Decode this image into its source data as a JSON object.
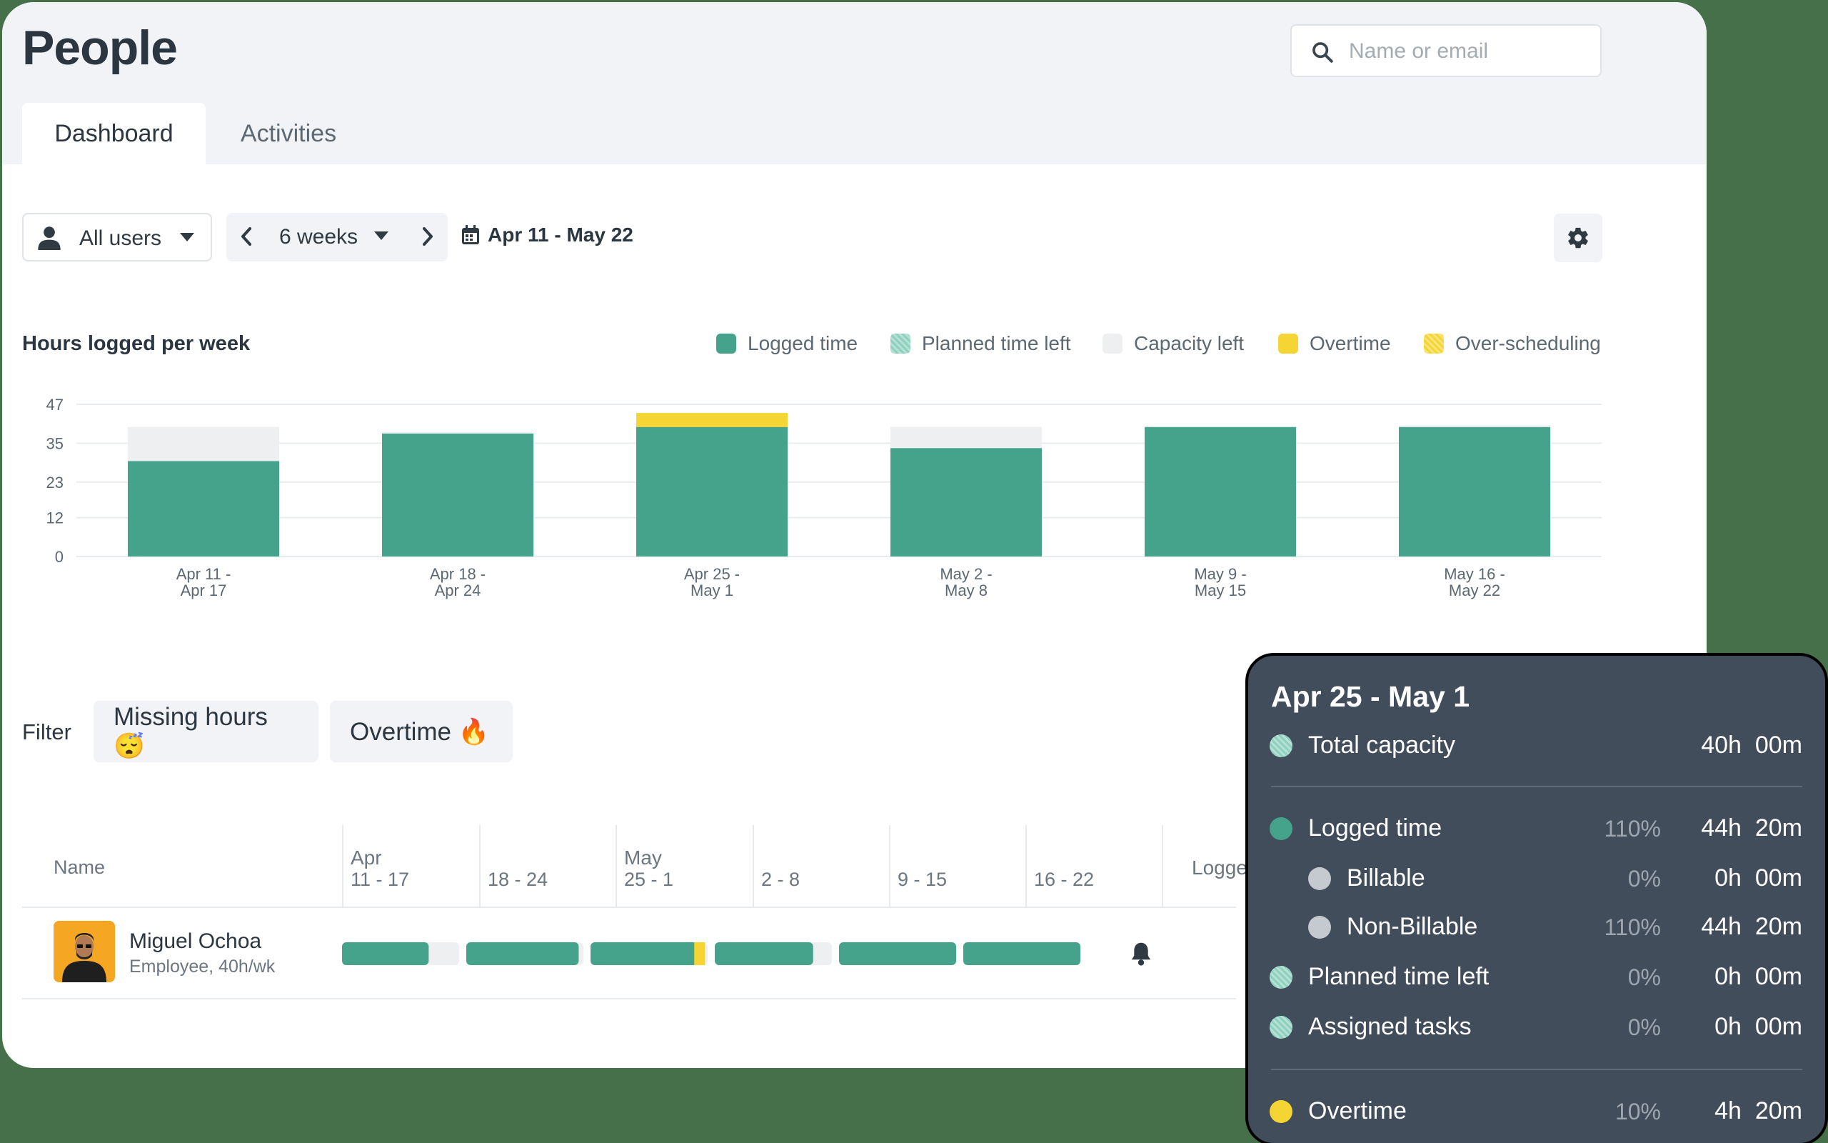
{
  "header": {
    "title": "People",
    "search_placeholder": "Name or email"
  },
  "tabs": [
    {
      "label": "Dashboard",
      "active": true
    },
    {
      "label": "Activities",
      "active": false
    }
  ],
  "toolbar": {
    "users_label": "All users",
    "weeks_label": "6 weeks",
    "date_range": "Apr 11 - May 22"
  },
  "colors": {
    "logged": "#46a38b",
    "planned": "#9fd4c3",
    "capacity": "#eeeff1",
    "overtime": "#f5d533",
    "accent_bg": "#46704a"
  },
  "chart_data": {
    "type": "bar",
    "title": "Hours logged per week",
    "legend": [
      "Logged time",
      "Planned time left",
      "Capacity left",
      "Overtime",
      "Over-scheduling"
    ],
    "legend_position": "top-right",
    "categories": [
      [
        "Apr 11 -",
        "Apr 17"
      ],
      [
        "Apr 18 -",
        "Apr 24"
      ],
      [
        "Apr 25 -",
        "May 1"
      ],
      [
        "May 2 -",
        "May 8"
      ],
      [
        "May 9 -",
        "May 15"
      ],
      [
        "May 16 -",
        "May 22"
      ]
    ],
    "y_ticks": [
      0,
      12,
      23,
      35,
      47
    ],
    "ylim": [
      0,
      47
    ],
    "grid": true,
    "series": [
      {
        "name": "Logged time",
        "values": [
          29.5,
          38,
          40,
          33.5,
          40,
          40
        ]
      },
      {
        "name": "Capacity left",
        "values": [
          10.5,
          0.5,
          0,
          6.5,
          0,
          0.5
        ]
      },
      {
        "name": "Overtime",
        "values": [
          0,
          0,
          4.33,
          0,
          0,
          0
        ]
      }
    ]
  },
  "filter": {
    "label": "Filter",
    "chips": [
      "Missing hours 😴",
      "Overtime 🔥"
    ]
  },
  "table": {
    "name_header": "Name",
    "week_headers": [
      {
        "month": "Apr",
        "range": "11 - 17"
      },
      {
        "month": "",
        "range": "18 - 24"
      },
      {
        "month": "May",
        "range": "25 - 1"
      },
      {
        "month": "",
        "range": "2 - 8"
      },
      {
        "month": "",
        "range": "9 - 15"
      },
      {
        "month": "",
        "range": "16 - 22"
      }
    ],
    "logged_header": "Logge",
    "rows": [
      {
        "name": "Miguel Ochoa",
        "subtitle": "Employee, 40h/wk",
        "week_fill": [
          {
            "logged": 0.74,
            "overtime": 0
          },
          {
            "logged": 0.96,
            "overtime": 0
          },
          {
            "logged": 0.91,
            "overtime": 0.09
          },
          {
            "logged": 0.84,
            "overtime": 0
          },
          {
            "logged": 1.0,
            "overtime": 0
          },
          {
            "logged": 1.0,
            "overtime": 0
          }
        ]
      }
    ]
  },
  "tooltip": {
    "title": "Apr 25 - May 1",
    "rows": [
      {
        "label": "Total capacity",
        "pct": "",
        "hours": "40h  00m",
        "dot": "hatch",
        "indent": false
      },
      {
        "label": "Logged time",
        "pct": "110%",
        "hours": "44h  20m",
        "dot": "#46a38b",
        "indent": false
      },
      {
        "label": "Billable",
        "pct": "0%",
        "hours": "0h  00m",
        "dot": "#c5cad0",
        "indent": true
      },
      {
        "label": "Non-Billable",
        "pct": "110%",
        "hours": "44h  20m",
        "dot": "#c5cad0",
        "indent": true
      },
      {
        "label": "Planned time left",
        "pct": "0%",
        "hours": "0h  00m",
        "dot": "hatch",
        "indent": false
      },
      {
        "label": "Assigned tasks",
        "pct": "0%",
        "hours": "0h  00m",
        "dot": "hatch",
        "indent": false
      },
      {
        "label": "Overtime",
        "pct": "10%",
        "hours": "4h  20m",
        "dot": "#f5d533",
        "indent": false
      }
    ]
  }
}
